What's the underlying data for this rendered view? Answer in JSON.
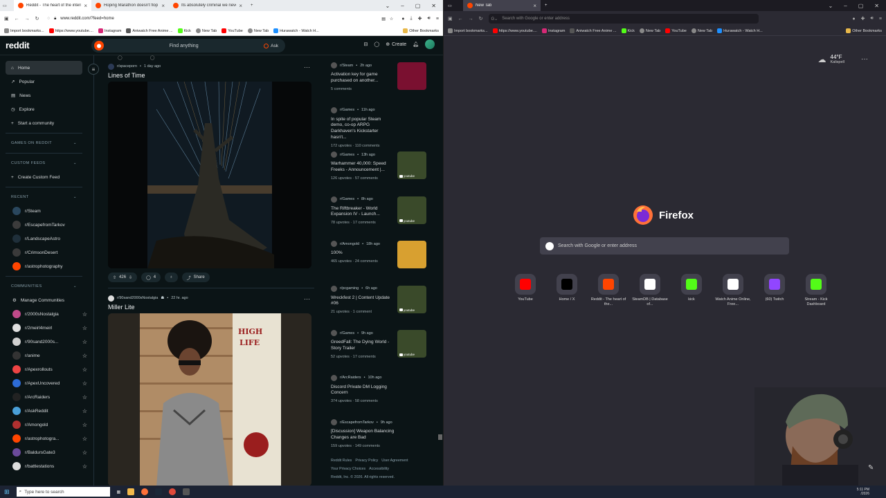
{
  "left_browser": {
    "tabs": [
      {
        "label": "Reddit - The heart of the intern",
        "active": true
      },
      {
        "label": "Hoping Marathon doesn't flop",
        "active": false
      },
      {
        "label": "Its absolutely criminal we never",
        "active": false
      }
    ],
    "url": "www.reddit.com/?feed=home",
    "bookmarks": [
      "Import bookmarks...",
      "https://www.youtube....",
      "Instagram",
      "Aniwatch Free Anime ...",
      "Kick",
      "New Tab",
      "YouTube",
      "New Tab",
      "Hurawatch - Watch H..."
    ],
    "other_bookmarks": "Other Bookmarks"
  },
  "reddit": {
    "logo": "reddit",
    "search_placeholder": "Find anything",
    "ask_label": "Ask",
    "create_label": "Create",
    "nav": [
      {
        "label": "Home",
        "icon": "home-icon"
      },
      {
        "label": "Popular",
        "icon": "popular-icon"
      },
      {
        "label": "News",
        "icon": "news-icon"
      },
      {
        "label": "Explore",
        "icon": "explore-icon"
      },
      {
        "label": "Start a community",
        "icon": "plus-icon"
      }
    ],
    "sections": {
      "games": "GAMES ON REDDIT",
      "custom_feeds": "CUSTOM FEEDS",
      "create_custom_feed": "Create Custom Feed",
      "recent": "RECENT",
      "communities": "COMMUNITIES",
      "manage": "Manage Communities"
    },
    "recent": [
      {
        "name": "r/Steam",
        "color": "#2a475e"
      },
      {
        "name": "r/EscapefromTarkov",
        "color": "#3b3b3b"
      },
      {
        "name": "r/LandscapeAstro",
        "color": "#1f2f3a"
      },
      {
        "name": "r/CrimsonDesert",
        "color": "#3a3a3a"
      },
      {
        "name": "r/astrophotography",
        "color": "#ff4500"
      }
    ],
    "communities": [
      {
        "name": "r/2000sNostalgia",
        "color": "#c04a8a"
      },
      {
        "name": "r/2meirl4meirl",
        "color": "#e0e0e0"
      },
      {
        "name": "r/90sand2000s...",
        "color": "#d0d0d0"
      },
      {
        "name": "r/anime",
        "color": "#333"
      },
      {
        "name": "r/Apexrollouts",
        "color": "#e44"
      },
      {
        "name": "r/ApexUncovered",
        "color": "#2d6bd6"
      },
      {
        "name": "r/ArcRaiders",
        "color": "#222"
      },
      {
        "name": "r/AskReddit",
        "color": "#4a9fd8"
      },
      {
        "name": "r/Amongold",
        "color": "#b03030"
      },
      {
        "name": "r/astrophotogra...",
        "color": "#ff4500"
      },
      {
        "name": "r/BaldursGate3",
        "color": "#6b4a9a"
      },
      {
        "name": "r/battlestations",
        "color": "#ddd"
      }
    ],
    "posts": [
      {
        "sub": "r/spaceporn",
        "time": "1 day ago",
        "title": "Lines of Time",
        "upvotes": "426",
        "comments": "4",
        "share": "Share"
      },
      {
        "sub": "r/90sand2000sNostalgia",
        "time": "22 hr. ago",
        "title": "Miller Lite"
      }
    ],
    "rail": [
      {
        "sub": "r/Steam",
        "time": "2h ago",
        "title": "Activation key for game purchased on another...",
        "stats": "5 comments",
        "thumb": "steam"
      },
      {
        "sub": "r/Games",
        "time": "11h ago",
        "title": "In spite of popular Steam demo, co-op ARPG Darkhaven's Kickstarter hasn't...",
        "stats": "172 upvotes · 110 comments",
        "thumb": ""
      },
      {
        "sub": "r/Games",
        "time": "13h ago",
        "title": "Warhammer 40,000: Speed Freeks - Announcement |...",
        "stats": "126 upvotes · 57 comments",
        "thumb": "youtube"
      },
      {
        "sub": "r/Games",
        "time": "8h ago",
        "title": "The Riftbreaker - World Expansion IV - Launch...",
        "stats": "78 upvotes · 17 comments",
        "thumb": "youtube"
      },
      {
        "sub": "r/Amongold",
        "time": "18h ago",
        "title": "100%",
        "stats": "465 upvotes · 24 comments",
        "thumb": "image"
      },
      {
        "sub": "r/pcgaming",
        "time": "6h ago",
        "title": "Wreckfest 2 | Content Update #06",
        "stats": "21 upvotes · 1 comment",
        "thumb": "youtube"
      },
      {
        "sub": "r/Games",
        "time": "9h ago",
        "title": "GreedFall: The Dying World - Story Trailer",
        "stats": "52 upvotes · 17 comments",
        "thumb": "youtube"
      },
      {
        "sub": "r/ArcRaiders",
        "time": "10h ago",
        "title": "Discord Private DM Logging Concern",
        "stats": "374 upvotes · 58 comments",
        "thumb": ""
      },
      {
        "sub": "r/EscapefromTarkov",
        "time": "9h ago",
        "title": "[Discussion] Weapon Balancing Changes are Bad",
        "stats": "159 upvotes · 149 comments",
        "thumb": ""
      }
    ],
    "footer": {
      "links1": [
        "Reddit Rules",
        "Privacy Policy",
        "User Agreement"
      ],
      "links2": [
        "Your Privacy Choices",
        "Accessibility"
      ],
      "copyright": "Reddit, Inc. © 2026. All rights reserved."
    },
    "youtube_badge": "youtube"
  },
  "right_browser": {
    "tab": "New Tab",
    "url_placeholder": "Search with Google or enter address",
    "bookmarks": [
      "Import bookmarks...",
      "https://www.youtube....",
      "Instagram",
      "Aniwatch Free Anime ...",
      "Kick",
      "New Tab",
      "YouTube",
      "New Tab",
      "Hurawatch - Watch H..."
    ],
    "other_bookmarks": "Other Bookmarks",
    "weather": {
      "temp": "44°F",
      "city": "Kalispell"
    },
    "brand": "Firefox",
    "search_placeholder": "Search with Google or enter address",
    "tiles": [
      {
        "label": "YouTube",
        "icon": "youtube-icon",
        "color": "#ff0000"
      },
      {
        "label": "Home / X",
        "icon": "x-icon",
        "color": "#000000"
      },
      {
        "label": "Reddit - The heart of the...",
        "icon": "reddit-icon",
        "color": "#ff4500"
      },
      {
        "label": "SteamDB | Database of...",
        "icon": "steamdb-icon",
        "color": "#ffffff"
      },
      {
        "label": "kick",
        "icon": "kick-icon",
        "color": "#53fc18"
      },
      {
        "label": "Watch Anime Online, Free...",
        "icon": "aniwatch-icon",
        "color": "#ffffff"
      },
      {
        "label": "(60) Twitch",
        "icon": "twitch-icon",
        "color": "#9146ff"
      },
      {
        "label": "Stream - Kick Dashboard",
        "icon": "kick-icon",
        "color": "#53fc18"
      }
    ]
  },
  "taskbar": {
    "search_placeholder": "Type here to search",
    "time": "5:11 PM",
    "date": "/2026"
  }
}
